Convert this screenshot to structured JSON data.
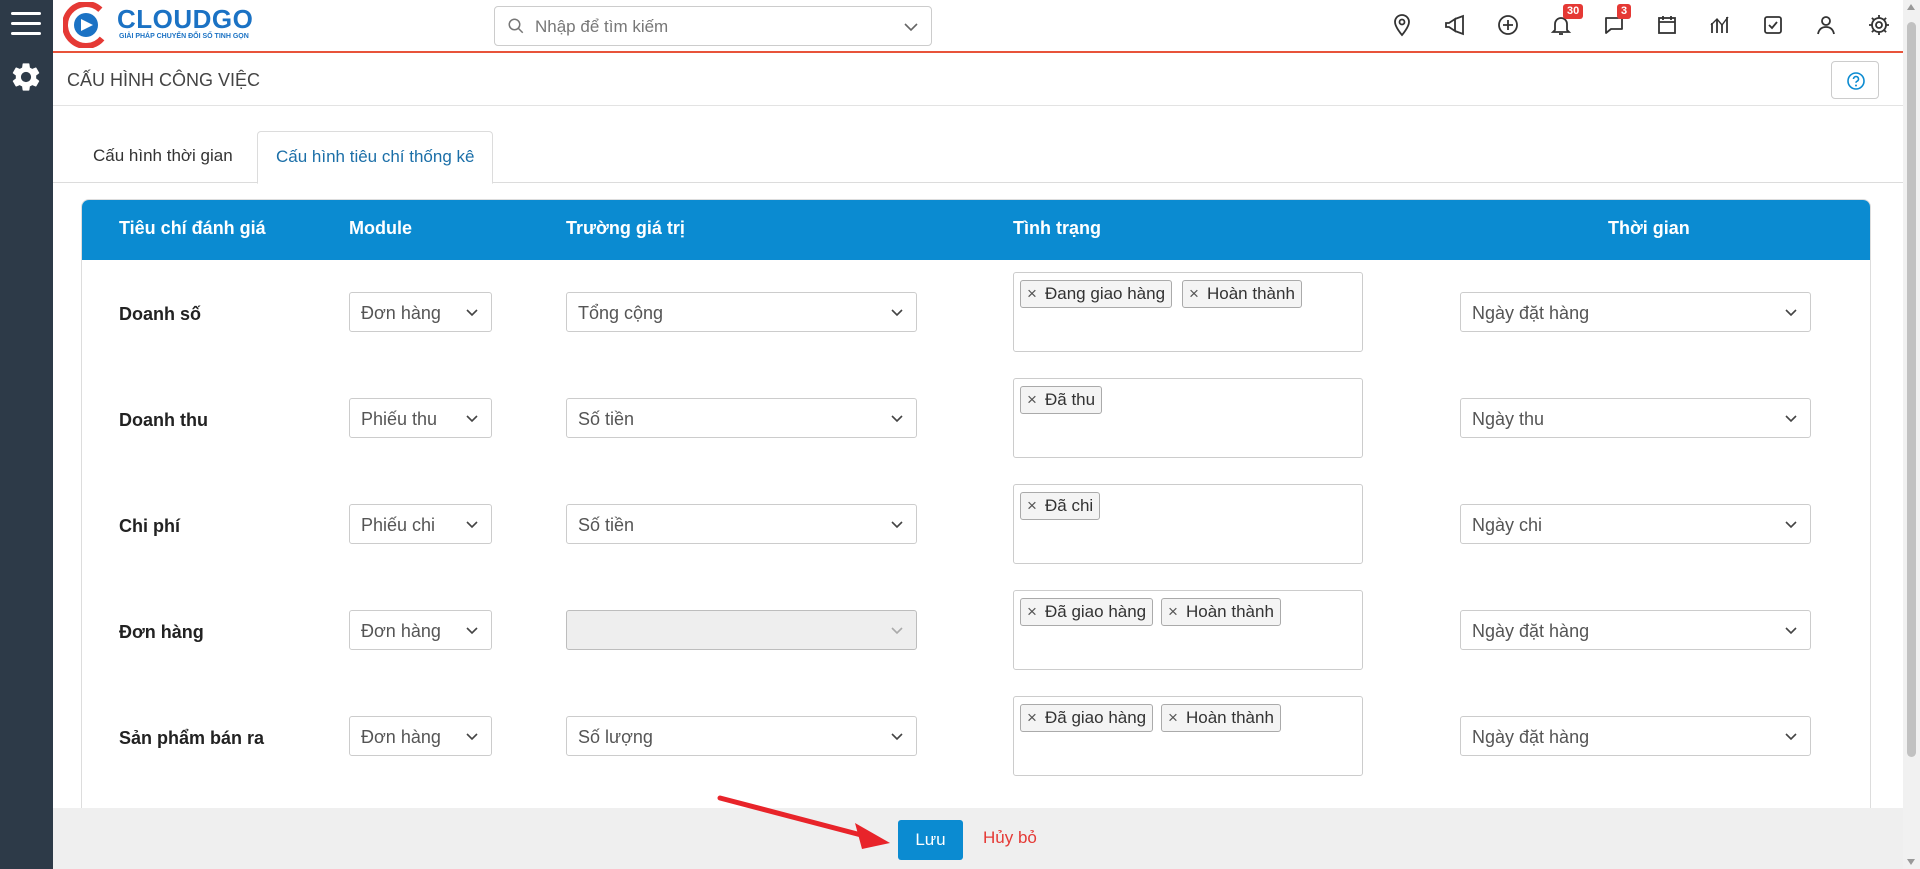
{
  "app": {
    "brand": "CLOUDGO",
    "slogan": "GIẢI PHÁP CHUYỂN ĐỔI SỐ TINH GỌN"
  },
  "search": {
    "placeholder": "Nhập để tìm kiếm"
  },
  "header": {
    "icons": [
      "map-pin-icon",
      "megaphone-icon",
      "plus-circle-icon",
      "bell-icon",
      "chat-icon",
      "calendar-icon",
      "chart-icon",
      "checkbox-icon",
      "user-icon",
      "gear-icon"
    ],
    "notifications_count": "30",
    "messages_count": "3"
  },
  "page": {
    "title": "CẤU HÌNH CÔNG VIỆC"
  },
  "tabs": [
    {
      "label": "Cấu hình thời gian"
    },
    {
      "label": "Cấu hình tiêu chí thống kê",
      "active": true
    }
  ],
  "table": {
    "headers": [
      "Tiêu chí đánh giá",
      "Module",
      "Trường giá trị",
      "Tình trạng",
      "Thời gian"
    ],
    "rows": [
      {
        "label": "Doanh số",
        "module": "Đơn hàng",
        "field": "Tổng cộng",
        "statuses": [
          "Đang giao hàng",
          "Hoàn thành"
        ],
        "time": "Ngày đặt hàng"
      },
      {
        "label": "Doanh thu",
        "module": "Phiếu thu",
        "field": "Số tiền",
        "statuses": [
          "Đã thu"
        ],
        "time": "Ngày thu"
      },
      {
        "label": "Chi phí",
        "module": "Phiếu chi",
        "field": "Số tiền",
        "statuses": [
          "Đã chi"
        ],
        "time": "Ngày chi"
      },
      {
        "label": "Đơn hàng",
        "module": "Đơn hàng",
        "field": "",
        "field_disabled": true,
        "statuses": [
          "Đã giao hàng",
          "Hoàn thành"
        ],
        "time": "Ngày đặt hàng"
      },
      {
        "label": "Sản phẩm bán ra",
        "module": "Đơn hàng",
        "field": "Số lượng",
        "statuses": [
          "Đã giao hàng",
          "Hoàn thành"
        ],
        "time": "Ngày đặt hàng"
      }
    ]
  },
  "footer": {
    "save_label": "Lưu",
    "cancel_label": "Hủy bỏ"
  },
  "colors": {
    "primary": "#0b8bd1",
    "sidebar": "#2d3a48",
    "accent_line": "#e8533a",
    "danger": "#e53935"
  }
}
